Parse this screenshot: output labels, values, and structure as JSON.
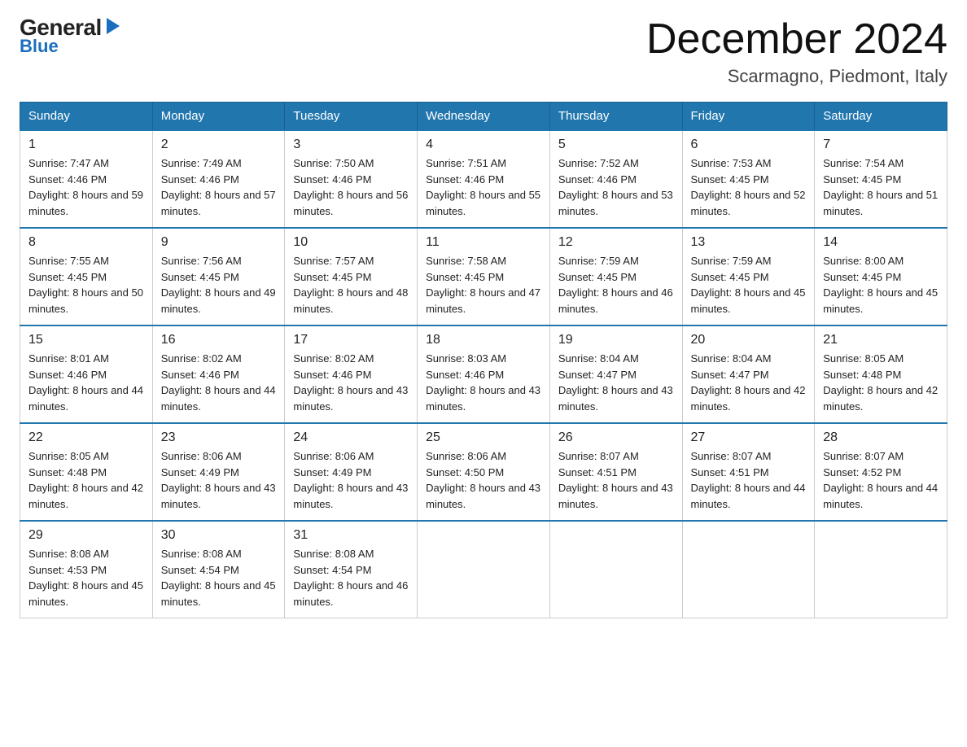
{
  "header": {
    "logo": {
      "general": "General",
      "blue": "Blue"
    },
    "month_title": "December 2024",
    "location": "Scarmagno, Piedmont, Italy"
  },
  "days_of_week": [
    "Sunday",
    "Monday",
    "Tuesday",
    "Wednesday",
    "Thursday",
    "Friday",
    "Saturday"
  ],
  "weeks": [
    [
      {
        "day": "1",
        "sunrise": "7:47 AM",
        "sunset": "4:46 PM",
        "daylight": "8 hours and 59 minutes."
      },
      {
        "day": "2",
        "sunrise": "7:49 AM",
        "sunset": "4:46 PM",
        "daylight": "8 hours and 57 minutes."
      },
      {
        "day": "3",
        "sunrise": "7:50 AM",
        "sunset": "4:46 PM",
        "daylight": "8 hours and 56 minutes."
      },
      {
        "day": "4",
        "sunrise": "7:51 AM",
        "sunset": "4:46 PM",
        "daylight": "8 hours and 55 minutes."
      },
      {
        "day": "5",
        "sunrise": "7:52 AM",
        "sunset": "4:46 PM",
        "daylight": "8 hours and 53 minutes."
      },
      {
        "day": "6",
        "sunrise": "7:53 AM",
        "sunset": "4:45 PM",
        "daylight": "8 hours and 52 minutes."
      },
      {
        "day": "7",
        "sunrise": "7:54 AM",
        "sunset": "4:45 PM",
        "daylight": "8 hours and 51 minutes."
      }
    ],
    [
      {
        "day": "8",
        "sunrise": "7:55 AM",
        "sunset": "4:45 PM",
        "daylight": "8 hours and 50 minutes."
      },
      {
        "day": "9",
        "sunrise": "7:56 AM",
        "sunset": "4:45 PM",
        "daylight": "8 hours and 49 minutes."
      },
      {
        "day": "10",
        "sunrise": "7:57 AM",
        "sunset": "4:45 PM",
        "daylight": "8 hours and 48 minutes."
      },
      {
        "day": "11",
        "sunrise": "7:58 AM",
        "sunset": "4:45 PM",
        "daylight": "8 hours and 47 minutes."
      },
      {
        "day": "12",
        "sunrise": "7:59 AM",
        "sunset": "4:45 PM",
        "daylight": "8 hours and 46 minutes."
      },
      {
        "day": "13",
        "sunrise": "7:59 AM",
        "sunset": "4:45 PM",
        "daylight": "8 hours and 45 minutes."
      },
      {
        "day": "14",
        "sunrise": "8:00 AM",
        "sunset": "4:45 PM",
        "daylight": "8 hours and 45 minutes."
      }
    ],
    [
      {
        "day": "15",
        "sunrise": "8:01 AM",
        "sunset": "4:46 PM",
        "daylight": "8 hours and 44 minutes."
      },
      {
        "day": "16",
        "sunrise": "8:02 AM",
        "sunset": "4:46 PM",
        "daylight": "8 hours and 44 minutes."
      },
      {
        "day": "17",
        "sunrise": "8:02 AM",
        "sunset": "4:46 PM",
        "daylight": "8 hours and 43 minutes."
      },
      {
        "day": "18",
        "sunrise": "8:03 AM",
        "sunset": "4:46 PM",
        "daylight": "8 hours and 43 minutes."
      },
      {
        "day": "19",
        "sunrise": "8:04 AM",
        "sunset": "4:47 PM",
        "daylight": "8 hours and 43 minutes."
      },
      {
        "day": "20",
        "sunrise": "8:04 AM",
        "sunset": "4:47 PM",
        "daylight": "8 hours and 42 minutes."
      },
      {
        "day": "21",
        "sunrise": "8:05 AM",
        "sunset": "4:48 PM",
        "daylight": "8 hours and 42 minutes."
      }
    ],
    [
      {
        "day": "22",
        "sunrise": "8:05 AM",
        "sunset": "4:48 PM",
        "daylight": "8 hours and 42 minutes."
      },
      {
        "day": "23",
        "sunrise": "8:06 AM",
        "sunset": "4:49 PM",
        "daylight": "8 hours and 43 minutes."
      },
      {
        "day": "24",
        "sunrise": "8:06 AM",
        "sunset": "4:49 PM",
        "daylight": "8 hours and 43 minutes."
      },
      {
        "day": "25",
        "sunrise": "8:06 AM",
        "sunset": "4:50 PM",
        "daylight": "8 hours and 43 minutes."
      },
      {
        "day": "26",
        "sunrise": "8:07 AM",
        "sunset": "4:51 PM",
        "daylight": "8 hours and 43 minutes."
      },
      {
        "day": "27",
        "sunrise": "8:07 AM",
        "sunset": "4:51 PM",
        "daylight": "8 hours and 44 minutes."
      },
      {
        "day": "28",
        "sunrise": "8:07 AM",
        "sunset": "4:52 PM",
        "daylight": "8 hours and 44 minutes."
      }
    ],
    [
      {
        "day": "29",
        "sunrise": "8:08 AM",
        "sunset": "4:53 PM",
        "daylight": "8 hours and 45 minutes."
      },
      {
        "day": "30",
        "sunrise": "8:08 AM",
        "sunset": "4:54 PM",
        "daylight": "8 hours and 45 minutes."
      },
      {
        "day": "31",
        "sunrise": "8:08 AM",
        "sunset": "4:54 PM",
        "daylight": "8 hours and 46 minutes."
      },
      null,
      null,
      null,
      null
    ]
  ],
  "labels": {
    "sunrise_prefix": "Sunrise: ",
    "sunset_prefix": "Sunset: ",
    "daylight_prefix": "Daylight: "
  }
}
